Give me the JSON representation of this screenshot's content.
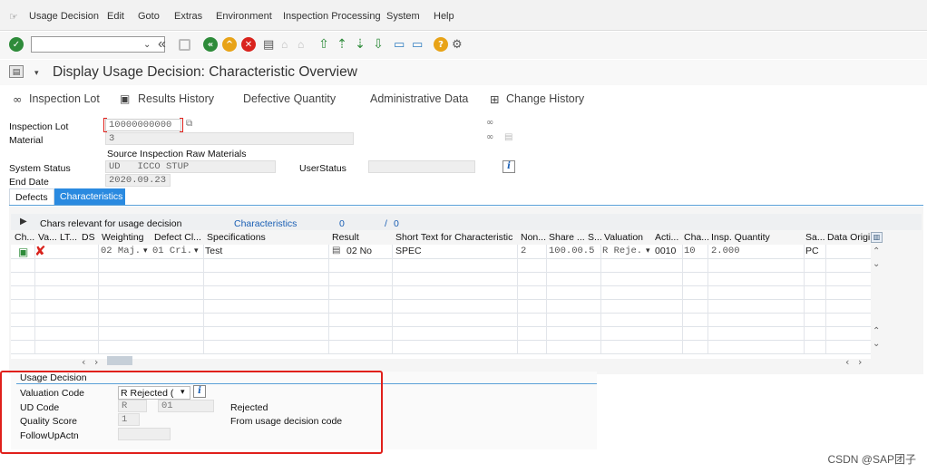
{
  "menu": {
    "items": [
      "Usage Decision",
      "Edit",
      "Goto",
      "Extras",
      "Environment",
      "Inspection Processing",
      "System",
      "Help"
    ]
  },
  "toolbar": {
    "command_value": ""
  },
  "title": "Display Usage Decision: Characteristic Overview",
  "app_toolbar": {
    "inspection_lot": "Inspection Lot",
    "results_history": "Results History",
    "defective_quantity": "Defective Quantity",
    "administrative_data": "Administrative Data",
    "change_history": "Change History"
  },
  "header": {
    "inspection_lot_label": "Inspection Lot",
    "inspection_lot_value": "10000000000",
    "material_label": "Material",
    "material_value": "3",
    "source_text": "Source Inspection Raw Materials",
    "system_status_label": "System Status",
    "system_status_value": "UD   ICCO STUP",
    "user_status_label": "UserStatus",
    "user_status_value": "",
    "end_date_label": "End Date",
    "end_date_value": "2020.09.23"
  },
  "tabs": {
    "defects": "Defects",
    "characteristics": "Characteristics"
  },
  "table_info": {
    "chars_label": "Chars relevant for usage decision",
    "characteristics_link": "Characteristics",
    "count_current": "0",
    "count_sep": "/",
    "count_total": "0"
  },
  "table": {
    "columns": [
      "Ch...",
      "Va...",
      "LT...",
      "DS",
      "Weighting",
      "Defect Cl...",
      "Specifications",
      "Result",
      "Short Text for Characteristic",
      "Non...",
      "Share ...",
      "S...",
      "Valuation",
      "Acti...",
      "Cha...",
      "Insp. Quantity",
      "Sa...",
      "Data Origi"
    ],
    "row": {
      "weighting": "02 Maj.",
      "defect_class": "01 Cri.",
      "specifications": "Test",
      "result": "02 No",
      "short_text": "SPEC",
      "non": "2",
      "share": "100.00.5",
      "valuation": "R Reje.",
      "activity": "0010",
      "cha": "10",
      "insp_qty": "2.000",
      "sa": "PC"
    }
  },
  "usage_decision": {
    "title": "Usage Decision",
    "valuation_label": "Valuation Code",
    "valuation_value": "R Rejected (",
    "ud_code_label": "UD Code",
    "ud_code_value": "R",
    "ud_code_group": "01",
    "ud_code_text": "Rejected",
    "quality_label": "Quality Score",
    "quality_value": "1",
    "quality_text": "From usage decision code",
    "followup_label": "FollowUpActn",
    "followup_value": ""
  },
  "watermark": "CSDN @SAP团子",
  "colors": {
    "accent_blue": "#1a5fb4",
    "tab_active": "#2a8ae0",
    "highlight_red": "#e0201b",
    "reject_red": "#d9231d",
    "ok_green": "#2e8b3a"
  }
}
